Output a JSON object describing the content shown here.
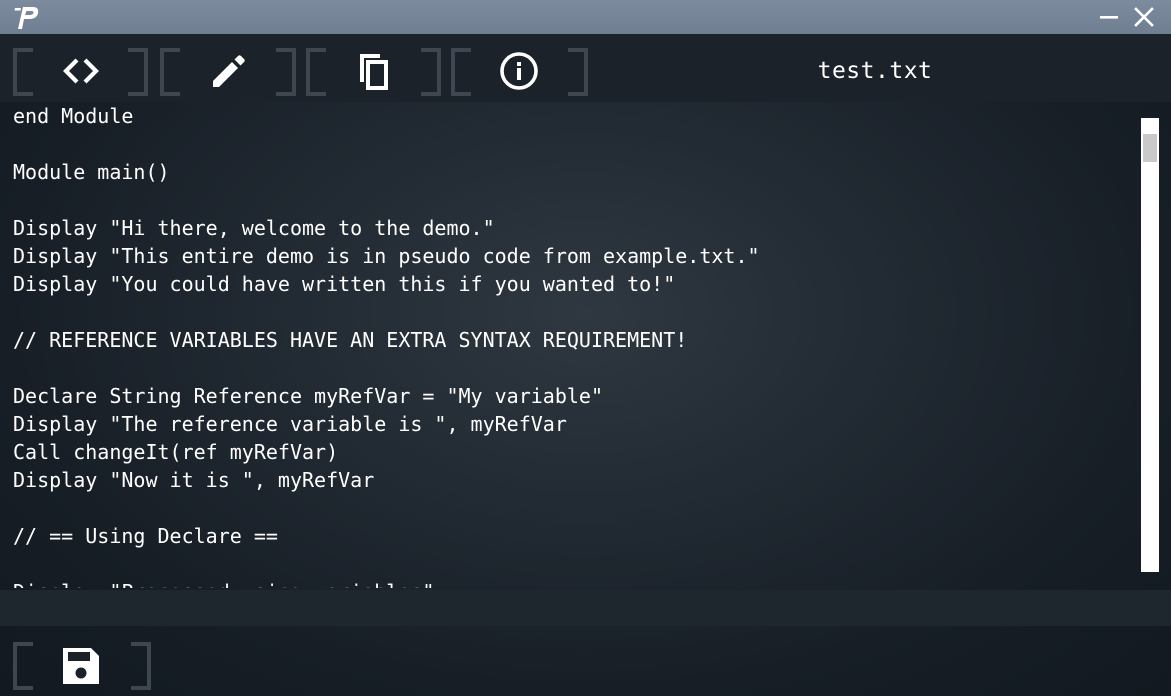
{
  "window": {
    "icons": {
      "logo": "app-logo-p",
      "minimize": "minimize-icon",
      "close": "close-icon"
    }
  },
  "toolbar": {
    "buttons": [
      {
        "id": "code",
        "icon": "code-icon"
      },
      {
        "id": "edit",
        "icon": "pencil-icon"
      },
      {
        "id": "copy",
        "icon": "copy-icon"
      },
      {
        "id": "info",
        "icon": "info-icon"
      }
    ],
    "filename": "test.txt"
  },
  "editor": {
    "lines": [
      "end Module",
      "",
      "Module main()",
      "",
      "Display \"Hi there, welcome to the demo.\"",
      "Display \"This entire demo is in pseudo code from example.txt.\"",
      "Display \"You could have written this if you wanted to!\"",
      "",
      "// REFERENCE VARIABLES HAVE AN EXTRA SYNTAX REQUIREMENT!",
      "",
      "Declare String Reference myRefVar = \"My variable\"",
      "Display \"The reference variable is \", myRefVar",
      "Call changeIt(ref myRefVar)",
      "Display \"Now it is \", myRefVar",
      "",
      "// == Using Declare ==",
      "",
      "Display \"Processed using variables\""
    ]
  },
  "bottombar": {
    "save_icon": "save-icon"
  },
  "colors": {
    "titlebar": "#75859a",
    "toolbar": "#1b222a",
    "bracket": "#3e4650",
    "icon": "#ffffff",
    "text": "#ffffff"
  }
}
